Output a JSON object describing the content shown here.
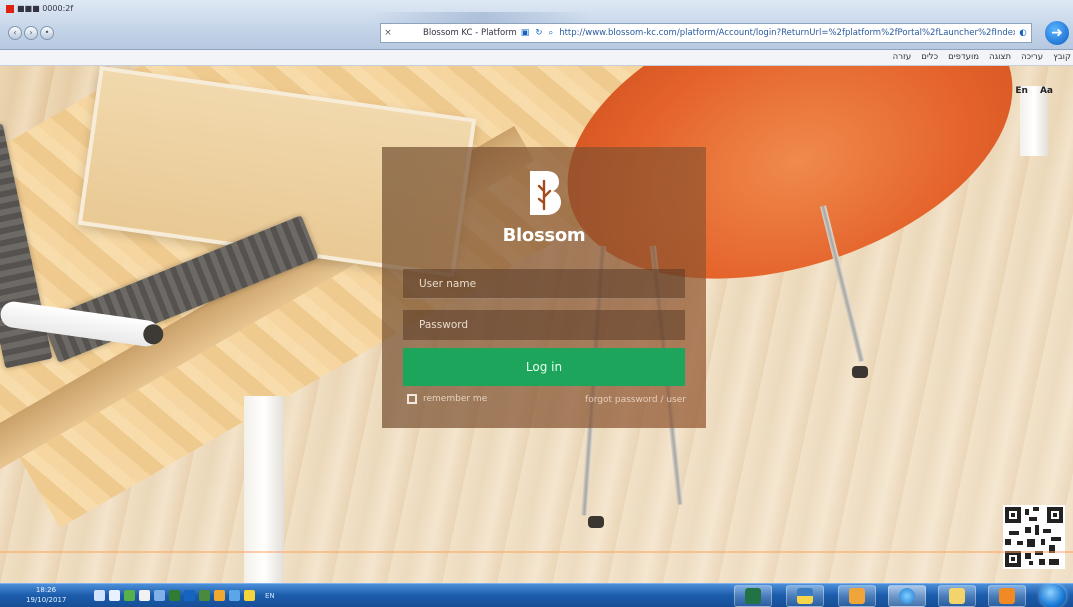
{
  "browser": {
    "window_title": "■■■ 0000:2f",
    "tab_title": "Blossom KC - Platform",
    "url": "http://www.blossom-kc.com/platform/Account/login?ReturnUrl=%2fplatform%2fPortal%2fLauncher%2fIndex",
    "menu_items": [
      "קובץ",
      "עריכה",
      "תצוגה",
      "מועדפים",
      "כלים",
      "עזרה"
    ],
    "nav_icons": [
      "back-icon",
      "forward-icon",
      "home-icon"
    ]
  },
  "page": {
    "lang_en": "En",
    "font_size": "Aa"
  },
  "login": {
    "brand_name": "Blossom",
    "logo_letter": "B",
    "username_placeholder": "User name",
    "password_placeholder": "Password",
    "login_label": "Log in",
    "remember_label": "remember me",
    "forgot_label": "forgot password / user"
  },
  "colors": {
    "login_button": "#1ea55c",
    "logo": "#ffffff",
    "panel": "rgba(120,82,50,0.62)"
  },
  "taskbar": {
    "clock_time": "18:26",
    "clock_date": "19/10/2017",
    "tray_lang": "EN",
    "apps": [
      "excel-icon",
      "python-icon",
      "outlook-icon",
      "internet-explorer-icon",
      "file-explorer-icon",
      "media-player-icon"
    ]
  }
}
